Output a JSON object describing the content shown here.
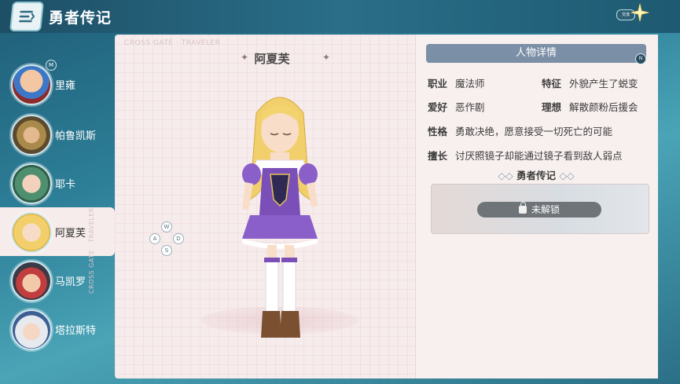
{
  "header": {
    "title": "勇者传记",
    "small_badge": "交流"
  },
  "sidebar": {
    "items": [
      {
        "label": "里雍",
        "badge": "M"
      },
      {
        "label": "帕鲁凯斯"
      },
      {
        "label": "耶卡"
      },
      {
        "label": "阿夏芙",
        "active": true
      },
      {
        "label": "马凯罗"
      },
      {
        "label": "塔拉斯特"
      }
    ]
  },
  "main": {
    "watermark": "CROSS GATE · TRAVELER",
    "character_name": "阿夏芙",
    "wasd": {
      "up": "W",
      "left": "A",
      "right": "D",
      "down": "S"
    }
  },
  "details": {
    "header": "人物详情",
    "badge": "N",
    "job_label": "职业",
    "job_value": "魔法师",
    "trait_label": "特征",
    "trait_value": "外貌产生了蜕变",
    "hobby_label": "爱好",
    "hobby_value": "恶作剧",
    "ideal_label": "理想",
    "ideal_value": "解散颜粉后援会",
    "personality_label": "性格",
    "personality_value": "勇敢决绝，愿意接受一切死亡的可能",
    "skill_label": "擅长",
    "skill_value": "讨厌照镜子却能通过镜子看到敌人弱点",
    "legend_title": "勇者传记",
    "unlock_label": "未解锁"
  },
  "colors": {
    "panel_bg": "#f7ecec",
    "header_bg": "#7b8fa6",
    "topbar": "#1d4f66"
  }
}
